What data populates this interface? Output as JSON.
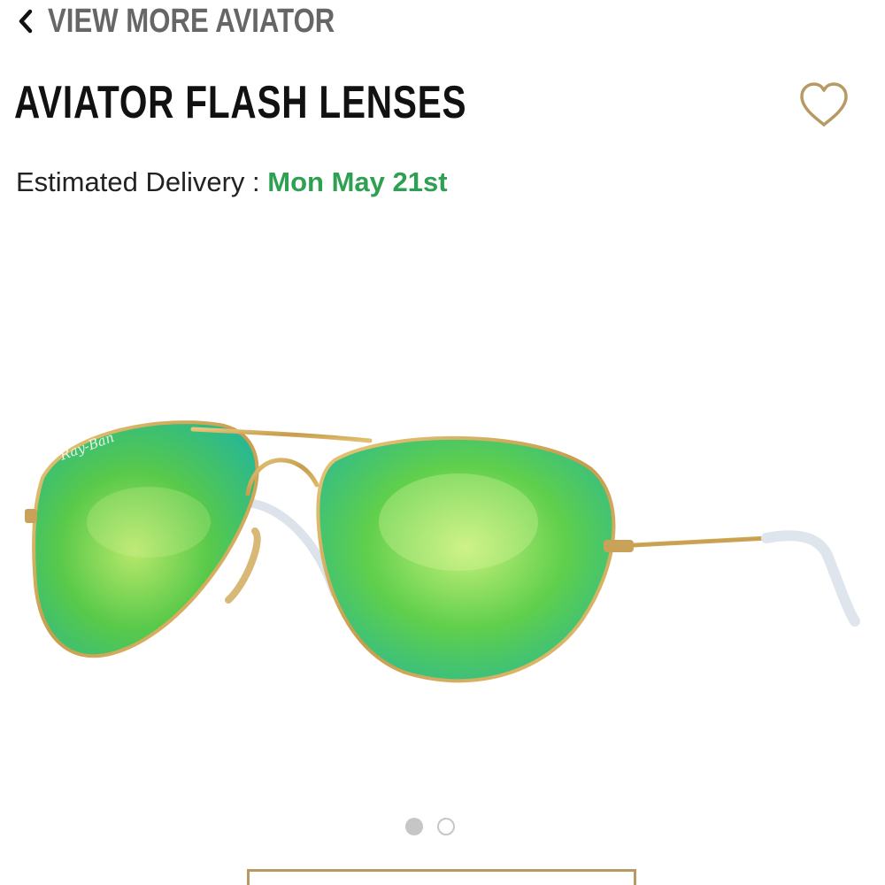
{
  "nav": {
    "back_label": "VIEW MORE AVIATOR",
    "back_icon": "chevron-left-icon"
  },
  "product": {
    "title": "AVIATOR FLASH LENSES",
    "favorite_icon": "heart-outline-icon",
    "brand_mark": "Ray-Ban",
    "delivery_label": "Estimated Delivery : ",
    "delivery_date": "Mon May 21st"
  },
  "carousel": {
    "total_slides": 2,
    "active_slide": 1
  },
  "colors": {
    "accent_gold": "#b79a63",
    "delivery_green": "#2ea052",
    "muted_gray": "#666666"
  }
}
